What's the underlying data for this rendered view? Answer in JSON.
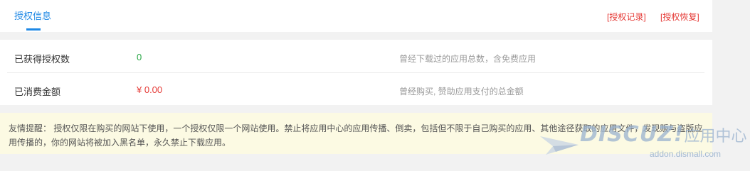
{
  "tabs": {
    "active_label": "授权信息"
  },
  "header_links": {
    "records": "[授权记录]",
    "restore": "[授权恢复]"
  },
  "info": {
    "rows": [
      {
        "label": "已获得授权数",
        "value": "0",
        "desc": "曾经下载过的应用总数，含免费应用"
      },
      {
        "label": "已消费金额",
        "value": "¥ 0.00",
        "desc": "曾经购买, 赞助应用支付的总金额"
      }
    ]
  },
  "notice": {
    "text": "友情提醒： 授权仅限在购买的网站下使用，一个授权仅限一个网站使用。禁止将应用中心的应用传播、倒卖，包括但不限于自己购买的应用、其他途径获取的应用文件，发现贩与盗版应用传播的，你的网站将被加入黑名单，永久禁止下载应用。"
  },
  "watermark": {
    "logo": "DISCUZ!",
    "logo_cn": "应用中心",
    "domain": "addon.dismall.com"
  },
  "colors": {
    "accent": "#1e88e5",
    "link_red": "#e53935",
    "value_green": "#28a745",
    "notice_bg": "#fcfae3"
  }
}
